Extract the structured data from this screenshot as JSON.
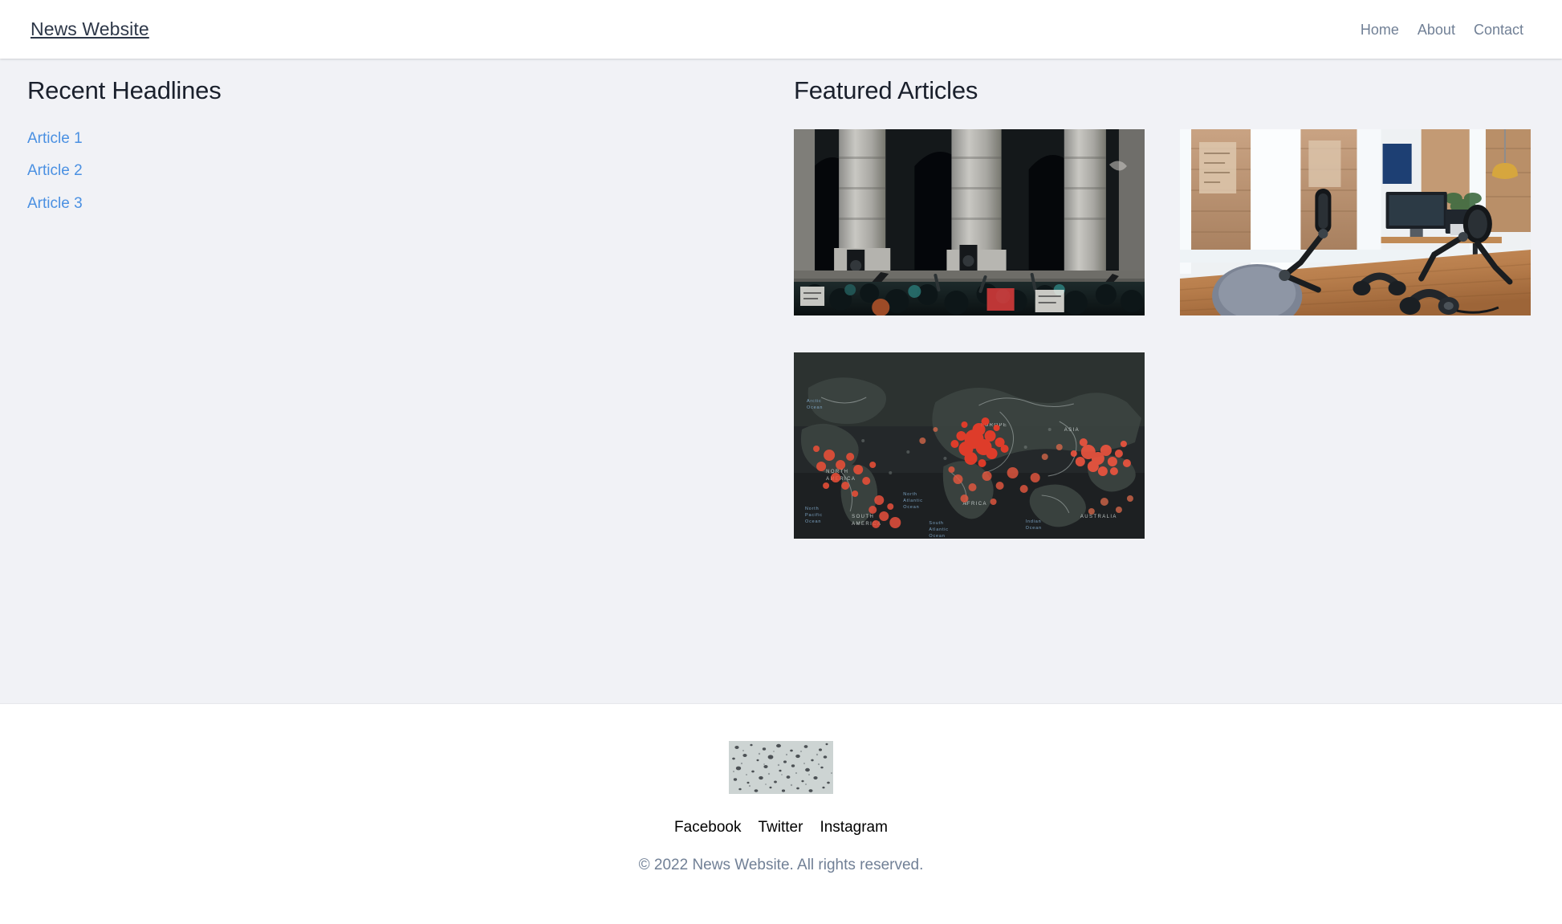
{
  "header": {
    "brand": "News Website",
    "nav": [
      {
        "label": "Home",
        "name": "nav-link-home"
      },
      {
        "label": "About",
        "name": "nav-link-about"
      },
      {
        "label": "Contact",
        "name": "nav-link-contact"
      }
    ]
  },
  "main": {
    "left": {
      "title": "Recent Headlines",
      "headlines": [
        {
          "label": "Article 1"
        },
        {
          "label": "Article 2"
        },
        {
          "label": "Article 3"
        }
      ]
    },
    "right": {
      "title": "Featured Articles",
      "cards": [
        {
          "alt": "protest-crowd-outside-classical-building-photo"
        },
        {
          "alt": "podcast-studio-desk-with-microphones-photo"
        },
        {
          "alt": "dark-world-map-with-red-outbreak-markers-photo"
        }
      ]
    }
  },
  "footer": {
    "logo_alt": "speckled-grey-texture-logo",
    "social": [
      {
        "label": "Facebook"
      },
      {
        "label": "Twitter"
      },
      {
        "label": "Instagram"
      }
    ],
    "copyright": "© 2022 News Website. All rights reserved."
  },
  "colors": {
    "page_background": "#f1f2f6",
    "surface": "#ffffff",
    "brand_text": "#2d3748",
    "nav_text": "#718096",
    "heading_text": "#1a202c",
    "link_accent": "#4a90e2",
    "social_text": "#000000",
    "copyright_text": "#718096"
  }
}
